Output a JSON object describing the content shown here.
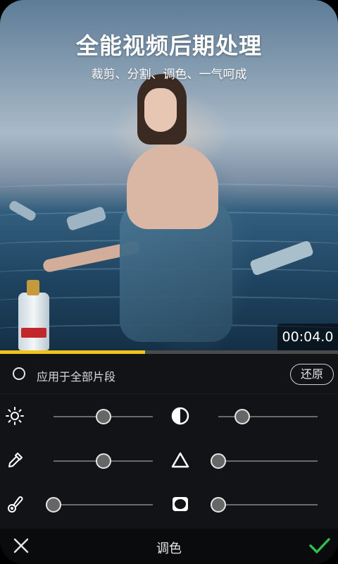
{
  "preview": {
    "title": "全能视频后期处理",
    "subtitle": "裁剪、分割、调色、一气呵成",
    "timestamp": "00:04.0",
    "progress_fraction": 0.43
  },
  "panel": {
    "apply_all_label": "应用于全部片段",
    "apply_all_checked": false,
    "restore_label": "还原",
    "controls": [
      {
        "name": "brightness",
        "icon": "sun-icon",
        "value": 0.5
      },
      {
        "name": "contrast",
        "icon": "contrast-icon",
        "value": 0.24
      },
      {
        "name": "saturation",
        "icon": "dropper-icon",
        "value": 0.5
      },
      {
        "name": "sharpen",
        "icon": "triangle-icon",
        "value": 0.0
      },
      {
        "name": "temperature",
        "icon": "thermometer-icon",
        "value": 0.0
      },
      {
        "name": "vignette",
        "icon": "vignette-icon",
        "value": 0.0
      }
    ]
  },
  "bottom_bar": {
    "title": "调色",
    "close_icon": "close-icon",
    "confirm_icon": "check-icon"
  },
  "colors": {
    "accent_yellow": "#f2c318",
    "confirm_green": "#2fbf4a"
  }
}
